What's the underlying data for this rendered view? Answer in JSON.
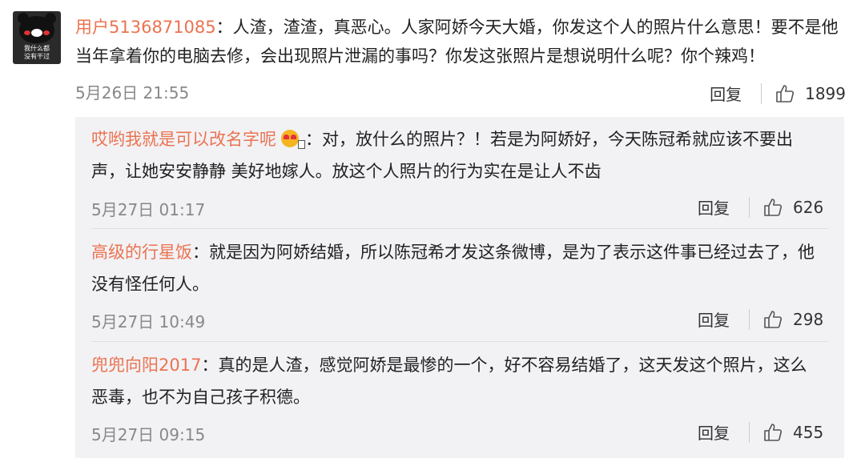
{
  "main_comment": {
    "avatar_caption": "我什么都\n没有干过",
    "username": "用户5136871085",
    "separator": "：",
    "text": "人渣，渣渣，真恶心。人家阿娇今天大婚，你发这个人的照片什么意思！要不是他当年拿着你的电脑去修，会出现照片泄漏的事吗？你发这张照片是想说明什么呢？你个辣鸡！",
    "time": "5月26日 21:55",
    "reply_label": "回复",
    "like_icon": "thumbs-up-icon",
    "likes": "1899"
  },
  "replies": [
    {
      "username": "哎哟我就是可以改名字呢",
      "emoji": "heart-eyes-emoji",
      "separator": "：",
      "text": "对，放什么的照片？！若是为阿娇好，今天陈冠希就应该不要出声，让她安安静静 美好地嫁人。放这个人照片的行为实在是让人不齿",
      "time": "5月27日 01:17",
      "reply_label": "回复",
      "likes": "626"
    },
    {
      "username": "高级的行星饭",
      "separator": "：",
      "text": "就是因为阿娇结婚，所以陈冠希才发这条微博，是为了表示这件事已经过去了，他没有怪任何人。",
      "time": "5月27日 10:49",
      "reply_label": "回复",
      "likes": "298"
    },
    {
      "username": "兜兜向阳2017",
      "separator": "：",
      "text": "真的是人渣，感觉阿娇是最惨的一个，好不容易结婚了，这天发这个照片，这么恶毒，也不为自己孩子积德。",
      "time": "5月27日 09:15",
      "reply_label": "回复",
      "likes": "455"
    }
  ],
  "colors": {
    "username": "#eb7350",
    "text": "#222222",
    "meta": "#888888",
    "reply_bg": "#f2f2f5"
  }
}
